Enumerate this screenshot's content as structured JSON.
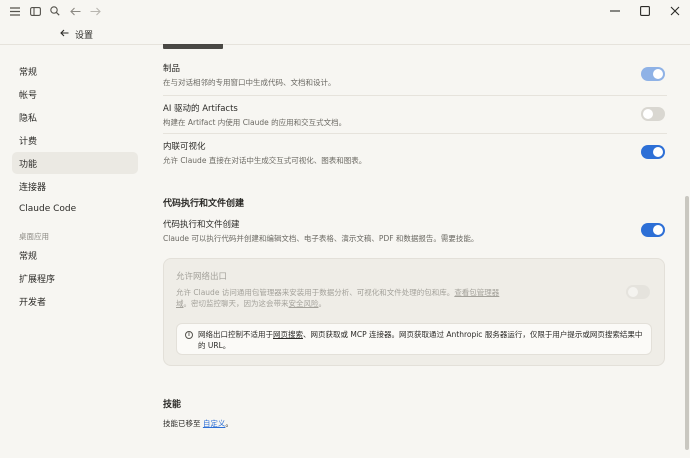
{
  "header": {
    "back_label": "设置"
  },
  "sidebar": {
    "items": [
      {
        "label": "常规"
      },
      {
        "label": "帐号"
      },
      {
        "label": "隐私"
      },
      {
        "label": "计费"
      },
      {
        "label": "功能",
        "active": true
      },
      {
        "label": "连接器"
      },
      {
        "label": "Claude Code"
      }
    ],
    "desktop_section_label": "桌面应用",
    "desktop_items": [
      {
        "label": "常规"
      },
      {
        "label": "扩展程序"
      },
      {
        "label": "开发者"
      }
    ]
  },
  "settings": {
    "artifacts": {
      "title": "制品",
      "desc": "在与对话相邻的专用窗口中生成代码、文档和设计。",
      "state": "on"
    },
    "ai_artifacts": {
      "title": "AI 驱动的 Artifacts",
      "desc": "构建在 Artifact 内使用 Claude 的应用和交互式文档。",
      "state": "off"
    },
    "inline_viz": {
      "title": "内联可视化",
      "desc": "允许 Claude 直接在对话中生成交互式可视化、图表和图表。",
      "state": "on"
    },
    "code_section_heading": "代码执行和文件创建",
    "code_exec": {
      "title": "代码执行和文件创建",
      "desc": "Claude 可以执行代码并创建和编辑文档、电子表格、演示文稿、PDF 和数据报告。需要技能。",
      "state": "on"
    },
    "network": {
      "title": "允许网络出口",
      "desc_prefix": "允许 Claude 访问通用包管理器来安装用于数据分析、可视化和文件处理的包和库。",
      "desc_link1": "查看包管理器域",
      "desc_mid": "。密切监控聊天，因为这会带来",
      "desc_link2": "安全风险",
      "desc_suffix": "。",
      "state": "off-disabled",
      "notice_prefix": "网络出口控制不适用于",
      "notice_link1": "网页搜索",
      "notice_mid1": "、网页获取或 MCP 连接器。网页获取通过 Anthropic 服务器运行，仅限于用户提示或网页搜索结果中的 URL",
      "notice_suffix": "。"
    },
    "skills_heading": "技能",
    "skills_text_prefix": "技能已移至 ",
    "skills_link": "自定义",
    "skills_text_suffix": "。"
  },
  "icons": {
    "menu": "menu-icon",
    "sidebar_toggle": "sidebar-toggle-icon",
    "search": "search-icon",
    "back": "back-arrow-icon",
    "forward": "forward-arrow-icon",
    "minimize": "minimize-icon",
    "maximize": "maximize-icon",
    "close": "close-icon",
    "info": "info-icon"
  },
  "colors": {
    "accent": "#2d6fd6",
    "background": "#f7f6f2"
  }
}
